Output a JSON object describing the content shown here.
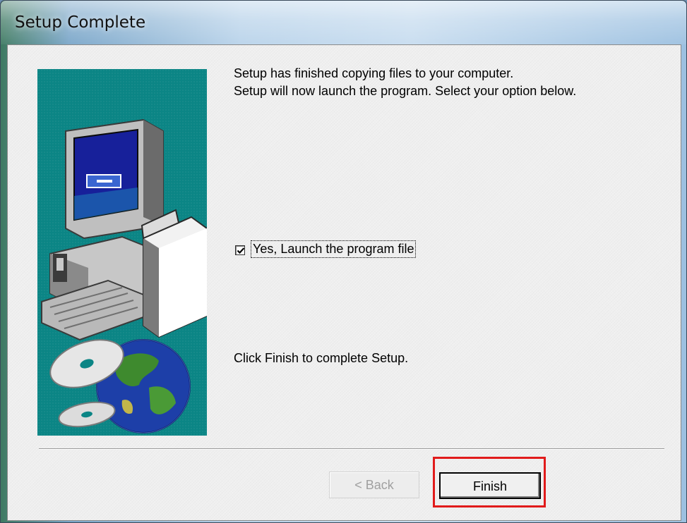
{
  "window": {
    "title": "Setup Complete"
  },
  "content": {
    "line1": "Setup has finished copying files to your computer.",
    "line2": "Setup will now launch the program. Select your option below.",
    "checkbox_label": "Yes, Launch the program file",
    "checkbox_checked": true,
    "finish_instruction": "Click Finish to complete Setup."
  },
  "buttons": {
    "back_label": "< Back",
    "back_enabled": false,
    "finish_label": "Finish"
  },
  "colors": {
    "highlight": "#e11b1b",
    "art_background": "#0b8585"
  },
  "icons": {
    "art": "setup-computer-globe-illustration",
    "check": "check-mark-icon"
  }
}
